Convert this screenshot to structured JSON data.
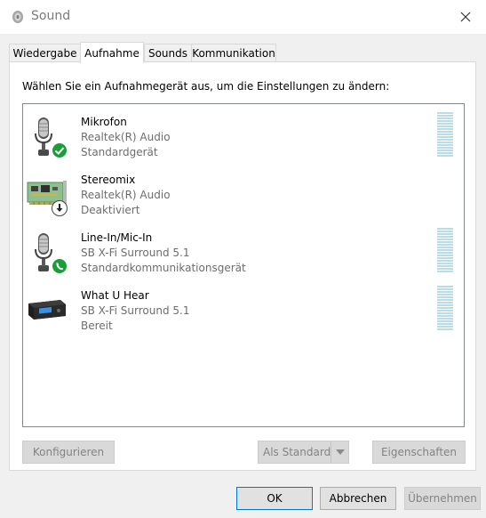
{
  "window": {
    "title": "Sound"
  },
  "tabs": [
    {
      "label": "Wiedergabe"
    },
    {
      "label": "Aufnahme"
    },
    {
      "label": "Sounds"
    },
    {
      "label": "Kommunikation"
    }
  ],
  "active_tab": "Aufnahme",
  "prompt": "Wählen Sie ein Aufnahmegerät aus, um die Einstellungen zu ändern:",
  "devices": [
    {
      "name": "Mikrofon",
      "driver": "Realtek(R) Audio",
      "status": "Standardgerät",
      "icon": "microphone-icon",
      "badge": "check-badge-icon"
    },
    {
      "name": "Stereomix",
      "driver": "Realtek(R) Audio",
      "status": "Deaktiviert",
      "icon": "sound-card-icon",
      "badge": "disabled-badge-icon"
    },
    {
      "name": "Line-In/Mic-In",
      "driver": "SB X-Fi Surround 5.1",
      "status": "Standardkommunikationsgerät",
      "icon": "microphone-icon",
      "badge": "phone-badge-icon"
    },
    {
      "name": "What U Hear",
      "driver": "SB X-Fi Surround 5.1",
      "status": "Bereit",
      "icon": "audio-device-icon",
      "badge": ""
    }
  ],
  "buttons": {
    "configure": "Konfigurieren",
    "set_default": "Als Standard",
    "properties": "Eigenschaften",
    "ok": "OK",
    "cancel": "Abbrechen",
    "apply": "Übernehmen"
  },
  "colors": {
    "status_green": "#1a9e3a",
    "meter": "#b8dde6",
    "ok_border": "#0078d7"
  }
}
